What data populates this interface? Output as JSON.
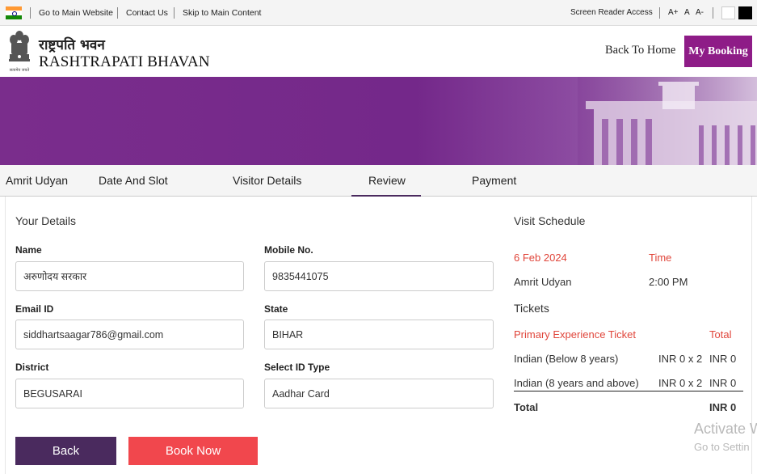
{
  "topbar": {
    "links": [
      "Go to Main Website",
      "Contact Us",
      "Skip to Main Content"
    ],
    "screen_reader": "Screen Reader Access",
    "font_sizes": [
      "A+",
      "A",
      "A-"
    ]
  },
  "header": {
    "title_hindi": "राष्ट्रपति भवन",
    "title_english": "RASHTRAPATI BHAVAN",
    "emblem_caption": "सत्यमेव जयते",
    "back_to_home": "Back To Home",
    "my_booking": "My Booking",
    "brand_color": "#8e1c87"
  },
  "banner": {
    "color": "#74288a"
  },
  "steps": {
    "items": [
      "Amrit Udyan",
      "Date And Slot",
      "Visitor Details",
      "Review",
      "Payment"
    ],
    "active": "Review"
  },
  "details": {
    "title": "Your Details",
    "name_label": "Name",
    "name_value": "अरुणोदय सरकार",
    "mobile_label": "Mobile No.",
    "mobile_value": "9835441075",
    "email_label": "Email ID",
    "email_value": "siddhartsaagar786@gmail.com",
    "state_label": "State",
    "state_value": "BIHAR",
    "district_label": "District",
    "district_value": "BEGUSARAI",
    "idtype_label": "Select ID Type",
    "idtype_value": "Aadhar Card"
  },
  "buttons": {
    "back": "Back",
    "book_now": "Book Now",
    "back_color": "#4a2a5e",
    "book_color": "#f1474d"
  },
  "schedule": {
    "title": "Visit Schedule",
    "date": "6 Feb 2024",
    "time_label": "Time",
    "venue": "Amrit Udyan",
    "time": "2:00 PM"
  },
  "tickets": {
    "title": "Tickets",
    "header_name": "Primary Experience Ticket",
    "header_total": "Total",
    "rows": [
      {
        "name": "Indian (Below 8 years)",
        "qty": "INR 0 x 2",
        "total": "INR 0"
      },
      {
        "name": "Indian (8 years and above)",
        "qty": "INR 0 x 2",
        "total": "INR 0"
      }
    ],
    "total_label": "Total",
    "total_value": "INR 0"
  },
  "watermark": {
    "line1": "Activate W",
    "line2": "Go to Settin"
  }
}
